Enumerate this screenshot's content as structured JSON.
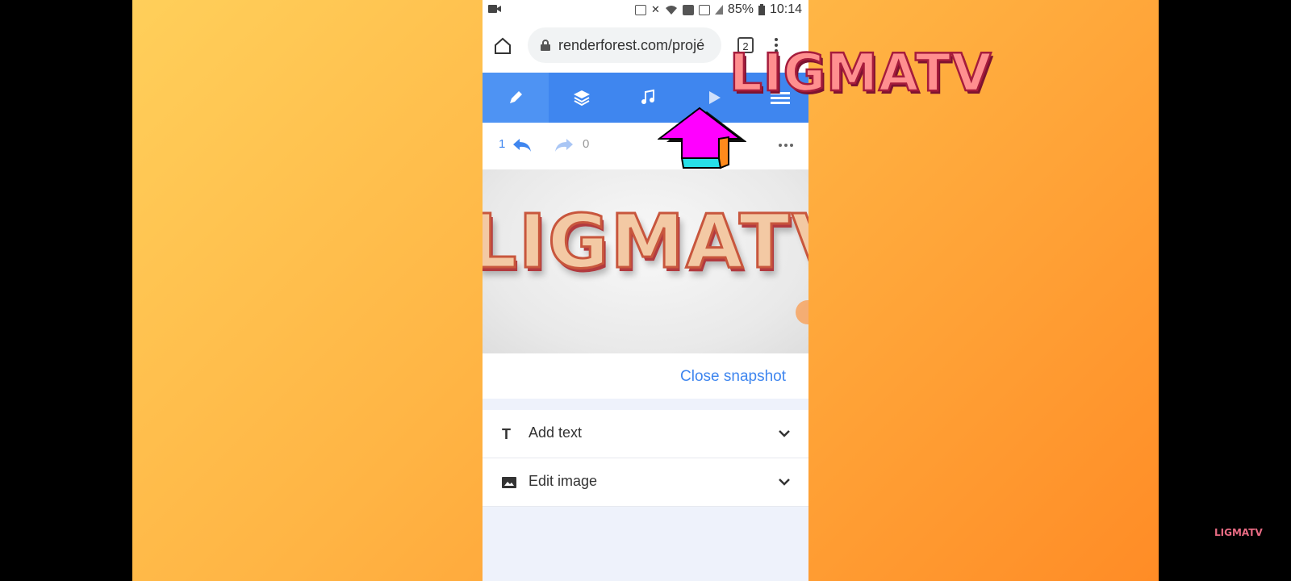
{
  "status_bar": {
    "battery": "85%",
    "time": "10:14"
  },
  "browser": {
    "url": "renderforest.com/projé",
    "tab_count": "2"
  },
  "editor": {
    "toolbar": [
      {
        "icon": "pencil-icon",
        "active": true
      },
      {
        "icon": "layers-icon",
        "active": false
      },
      {
        "icon": "music-note-icon",
        "active": false
      },
      {
        "icon": "play-icon",
        "active": false
      },
      {
        "icon": "hamburger-menu-icon",
        "active": false
      }
    ],
    "undo_count": "1",
    "redo_count": "0",
    "preview_logo": "LIGMATV",
    "close_snapshot": "Close snapshot",
    "sections": [
      {
        "icon": "text-icon",
        "label": "Add text"
      },
      {
        "icon": "image-icon",
        "label": "Edit image"
      }
    ]
  },
  "watermark": {
    "large": "LIGMATV",
    "small": "LIGMATV"
  },
  "colors": {
    "accent": "#3f86ef",
    "background_gradient_start": "#ffcf5a",
    "background_gradient_end": "#ff8c26",
    "pointer_arrow": "#ff00ff"
  }
}
